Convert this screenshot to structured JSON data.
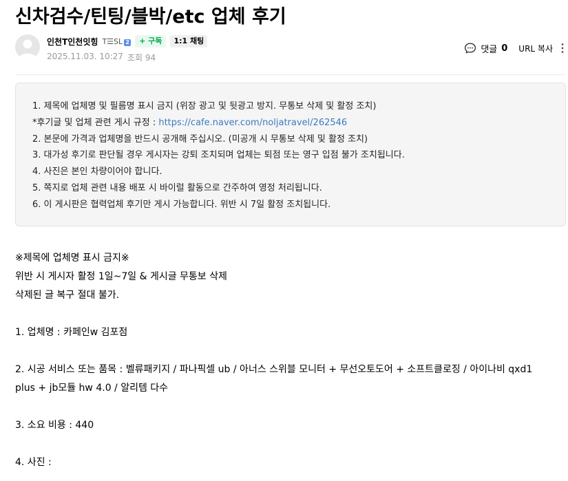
{
  "title": "신차검수/틴팅/블박/etc 업체 후기",
  "author": {
    "nickname": "인천T인천잇힝",
    "grade": "T☰SL",
    "grade_badge": "2",
    "subscribe_label": "+ 구독",
    "chat_label": "1:1 채팅"
  },
  "meta": {
    "datetime": "2025.11.03. 10:27",
    "views_label": "조회 94"
  },
  "tools": {
    "comment_label": "댓글",
    "comment_count": "0",
    "url_copy_label": "URL 복사"
  },
  "notice": {
    "line1": "1. 제목에 업체명 및 필름명 표시 금지 (위장 광고 및 뒷광고 방지. 무통보 삭제 및 활정 조치)",
    "line2_prefix": "*후기글 및 업체 관련 게시 규정 : ",
    "line2_link": "https://cafe.naver.com/noljatravel/262546",
    "line3": "2. 본문에 가격과 업체명을 반드시 공개해 주십시오. (미공개 시 무통보 삭제 및 활정 조치)",
    "line4": "3. 대가성 후기로 판단될 경우 게시자는 강퇴 조치되며 업체는 퇴점 또는 영구 입점 불가 조치됩니다.",
    "line5": "4. 사진은 본인 차량이어야 합니다.",
    "line6": "5. 쪽지로 업체 관련 내용 배포 시 바이럴 활동으로 간주하여 영정 처리됩니다.",
    "line7": "6. 이 게시판은 협력업체 후기만 게시 가능합니다. 위반 시 7일 활정 조치됩니다."
  },
  "body": {
    "warn1": "※제목에 업체명 표시 금지※",
    "warn2": "위반 시 게시자 활정 1일~7일 & 게시글 무통보 삭제",
    "warn3": "삭제된 글 복구 절대 불가.",
    "q1": "1. 업체명 :  카페인w 김포점",
    "q2_line1": "2. 시공 서비스 또는 품목 :  벨류패키지 / 파나픽셀 ub / 아너스 스위블 모니터 + 무선오토도어 + 소프트클로징 / 아이나비 qxd1",
    "q2_line2": "plus + jb모듈 hw 4.0 / 알리템 다수",
    "q3": "3. 소요 비용 :  440",
    "q4": "4. 사진 :"
  }
}
